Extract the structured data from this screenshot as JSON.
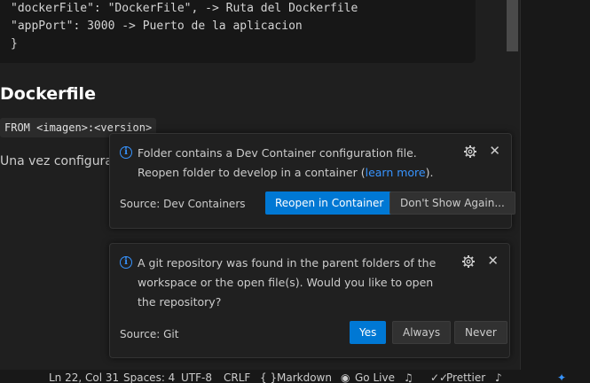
{
  "editor": {
    "code_lines": [
      "\"dockerFile\": \"DockerFile\", -> Ruta del Dockerfile",
      "\"appPort\": 3000 -> Puerto de la aplicacion",
      "}"
    ],
    "heading": "Dockerfile",
    "inline_code": "FROM <imagen>:<version>",
    "paragraph": "Una vez configura"
  },
  "notifications": [
    {
      "message_before_link": "Folder contains a Dev Container configuration file. Reopen folder to develop in a container (",
      "link_text": "learn more",
      "message_after_link": ").",
      "source": "Source: Dev Containers",
      "buttons": [
        "Reopen in Container",
        "Don't Show Again..."
      ],
      "icon": "info-icon"
    },
    {
      "message": "A git repository was found in the parent folders of the workspace or the open file(s). Would you like to open the repository?",
      "source": "Source: Git",
      "buttons": [
        "Yes",
        "Always",
        "Never"
      ],
      "icon": "info-icon"
    }
  ],
  "statusbar": {
    "position": "Ln 22, Col 31",
    "spaces": "Spaces: 4",
    "encoding": "UTF-8",
    "eol": "CRLF",
    "language_braces": "{ }",
    "language": "Markdown",
    "golive": "Go Live",
    "prettier": "Prettier"
  },
  "colors": {
    "accent": "#0078d4",
    "link": "#3794ff",
    "background": "#1f1f1f"
  }
}
